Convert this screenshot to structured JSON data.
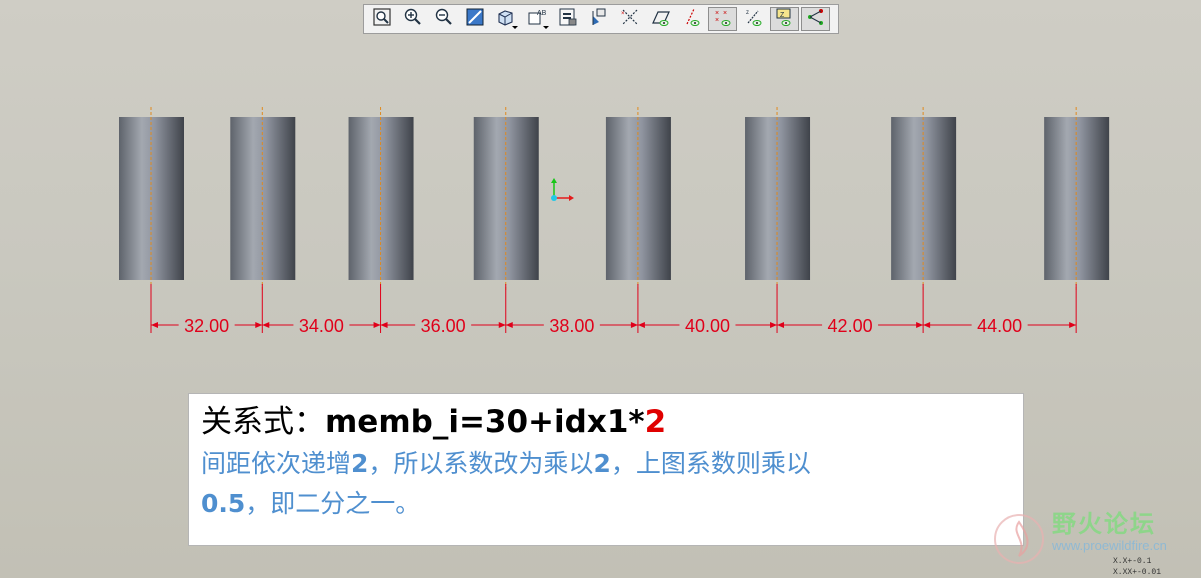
{
  "toolbar": {
    "buttons": [
      {
        "name": "zoom-fit-button",
        "icon": "zoom-fit-icon",
        "active": false,
        "caret": false
      },
      {
        "name": "zoom-in-button",
        "icon": "zoom-in-icon",
        "active": false,
        "caret": false
      },
      {
        "name": "zoom-out-button",
        "icon": "zoom-out-icon",
        "active": false,
        "caret": false
      },
      {
        "name": "repaint-button",
        "icon": "repaint-icon",
        "active": false,
        "caret": false
      },
      {
        "name": "display-style-button",
        "icon": "display-style-icon",
        "active": false,
        "caret": true
      },
      {
        "name": "saved-views-button",
        "icon": "saved-views-icon",
        "active": false,
        "caret": true
      },
      {
        "name": "view-manager-button",
        "icon": "view-manager-icon",
        "active": false,
        "caret": false
      },
      {
        "name": "orient-button",
        "icon": "orient-icon",
        "active": false,
        "caret": false
      },
      {
        "name": "datum-axis-display-button",
        "icon": "datum-axis-icon",
        "active": false,
        "caret": false
      },
      {
        "name": "datum-plane-display-button",
        "icon": "datum-plane-icon",
        "active": false,
        "caret": false
      },
      {
        "name": "axis-display-button",
        "icon": "axis-display-icon",
        "active": false,
        "caret": false
      },
      {
        "name": "point-display-button",
        "icon": "point-display-icon",
        "active": true,
        "caret": false
      },
      {
        "name": "csys-display-button",
        "icon": "csys-display-icon",
        "active": false,
        "caret": false
      },
      {
        "name": "annotation-display-button",
        "icon": "annotation-display-icon",
        "active": true,
        "caret": false
      },
      {
        "name": "spin-center-button",
        "icon": "spin-center-icon",
        "active": true,
        "caret": false
      }
    ]
  },
  "model": {
    "part_color": "#8a8f97",
    "axis_color": "#e08a1e",
    "dimension_color": "#e0001a",
    "dimensions": [
      {
        "label": "32.00",
        "value": 32
      },
      {
        "label": "34.00",
        "value": 34
      },
      {
        "label": "36.00",
        "value": 36
      },
      {
        "label": "38.00",
        "value": 38
      },
      {
        "label": "40.00",
        "value": 40
      },
      {
        "label": "42.00",
        "value": 42
      },
      {
        "label": "44.00",
        "value": 44
      }
    ]
  },
  "note": {
    "label": "关系式：",
    "formula": "memb_i=30+idx1*",
    "formula_highlight": "2",
    "body_seg1": "间距依次递增",
    "body_num1": "2",
    "body_seg2": "，所以系数改为乘以",
    "body_num2": "2",
    "body_seg3": "，上图系数则乘以",
    "body_num3": "0.5",
    "body_seg4": "，即二分之一。"
  },
  "watermark": {
    "title": "野火论坛",
    "url": "www.proewildfire.cn"
  },
  "tolerance": {
    "line1": "X.X+-0.1",
    "line2": "X.XX+-0.01"
  }
}
